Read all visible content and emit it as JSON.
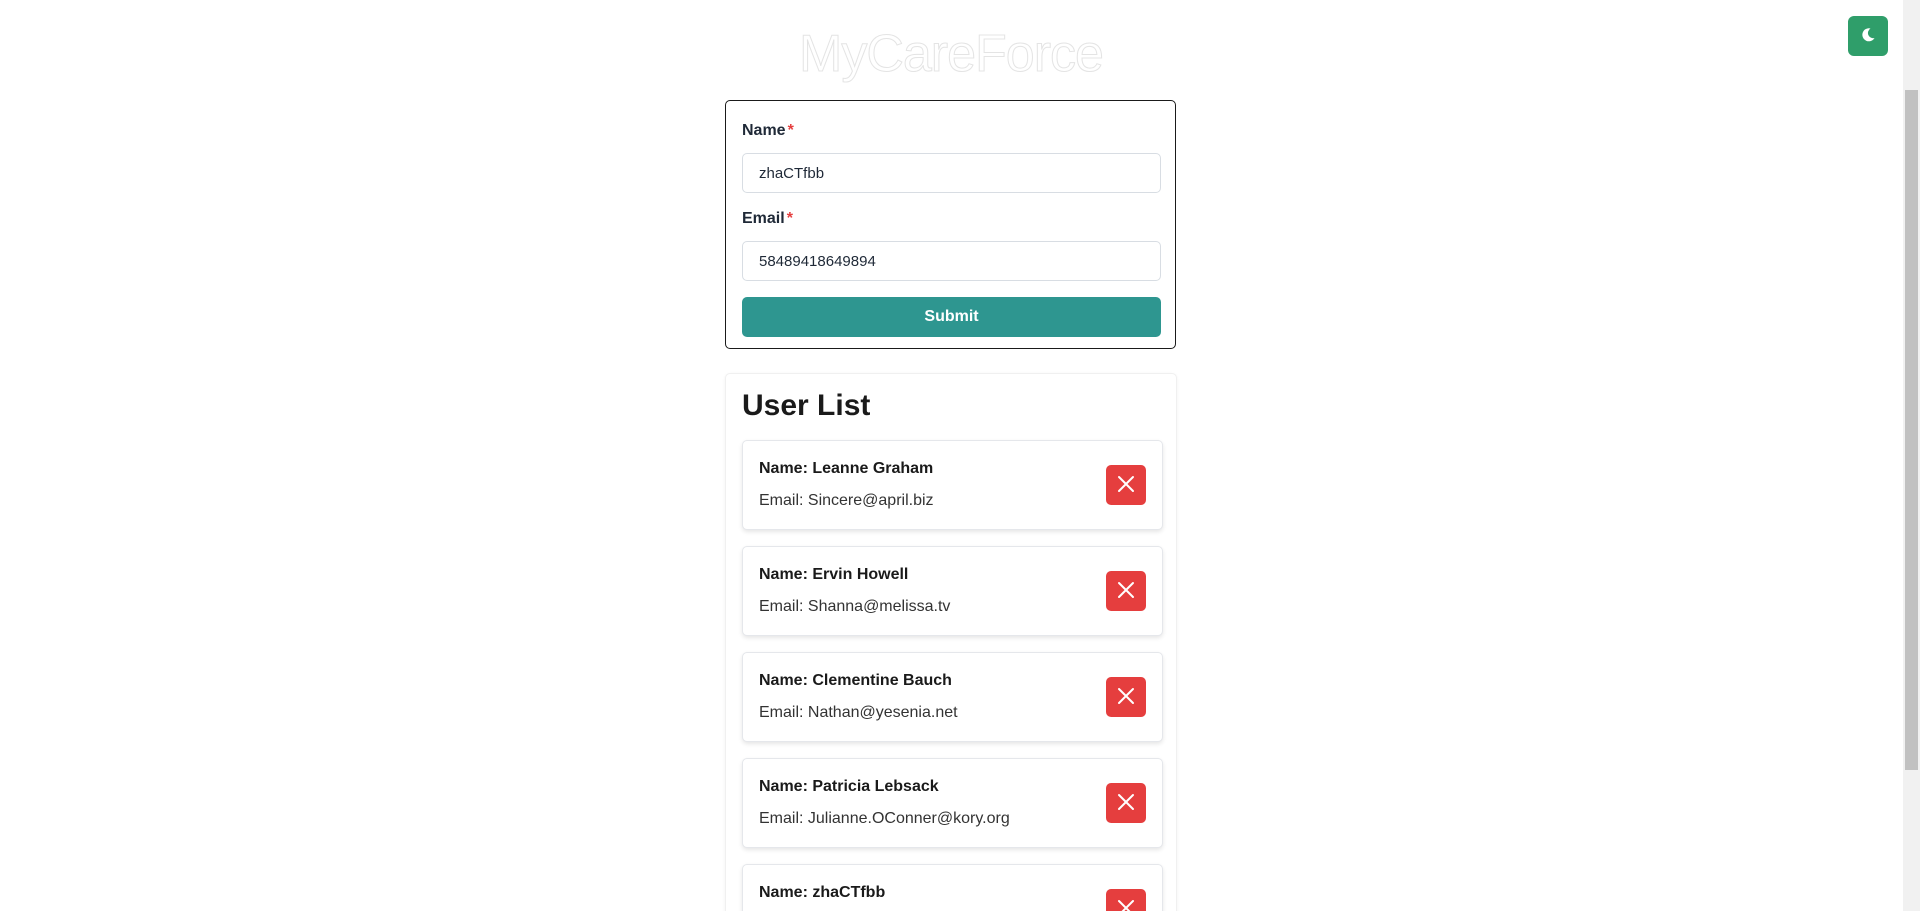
{
  "app": {
    "title": "MyCareForce",
    "theme_toggle_icon": "moon-icon",
    "accent_color": "#2f9e6a"
  },
  "form": {
    "name_label": "Name",
    "email_label": "Email",
    "required_marker": "*",
    "name_value": "zhaCTfbb",
    "email_value": "58489418649894",
    "submit_label": "Submit",
    "submit_color": "#2e9690"
  },
  "user_list": {
    "heading": "User List",
    "delete_icon": "close-icon",
    "delete_color": "#e53e3e",
    "users": [
      {
        "name": "Name: Leanne Graham",
        "email": "Email: Sincere@april.biz"
      },
      {
        "name": "Name: Ervin Howell",
        "email": "Email: Shanna@melissa.tv"
      },
      {
        "name": "Name: Clementine Bauch",
        "email": "Email: Nathan@yesenia.net"
      },
      {
        "name": "Name: Patricia Lebsack",
        "email": "Email: Julianne.OConner@kory.org"
      },
      {
        "name": "Name: zhaCTfbb",
        "email": ""
      }
    ]
  }
}
